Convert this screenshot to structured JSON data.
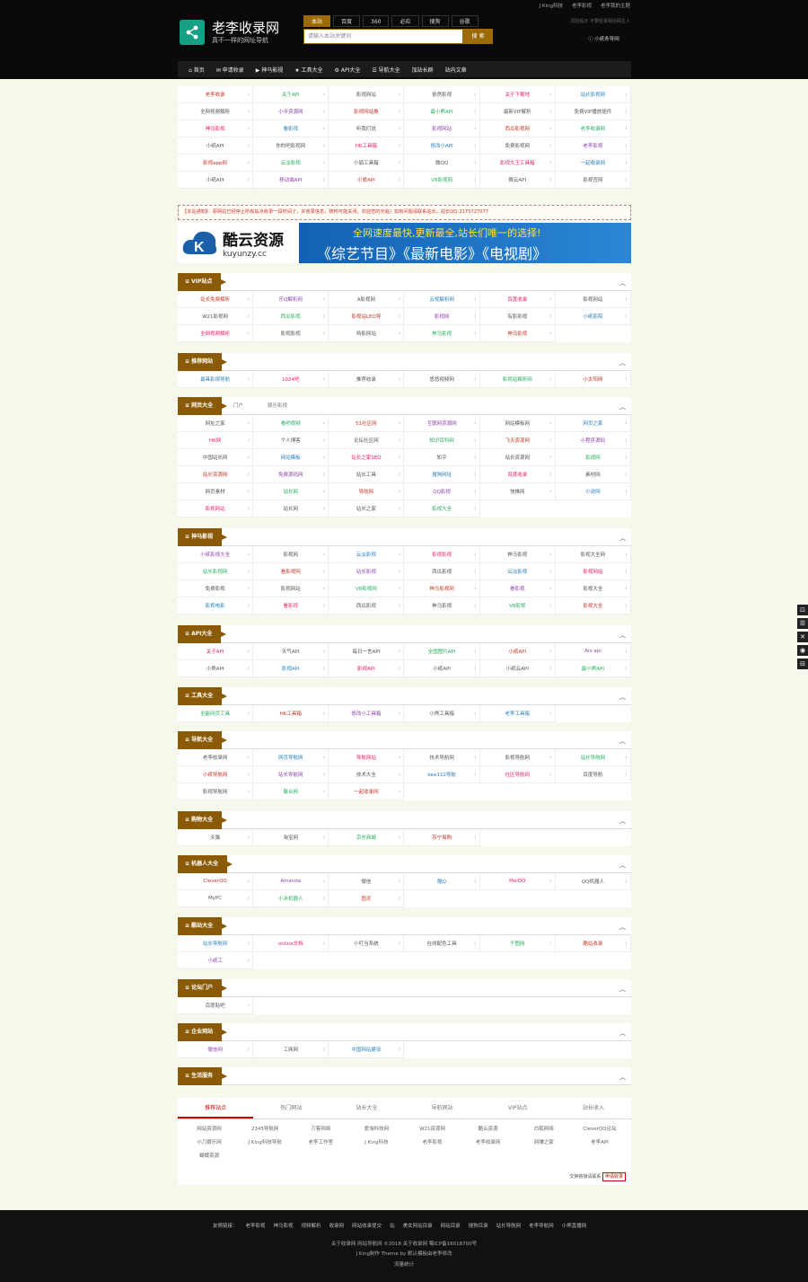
{
  "header": {
    "brand": "老李收录网",
    "slogan": "真不一样的网址导航",
    "search_tabs": [
      "本站",
      "百度",
      "360",
      "必应",
      "搜狗",
      "谷歌"
    ],
    "search_placeholder": "请输入本站关键词",
    "search_button": "搜 索",
    "top_links": [
      "J King科技",
      "老李影视",
      "老李我的主题"
    ],
    "weather": "风险提示 不要轻易相信陌生人",
    "mini": "小纸条导网"
  },
  "nav": [
    "首页",
    "申请收录",
    "神马影视",
    "工具大全",
    "API大全",
    "导航大全",
    "加站长群",
    "站内文章"
  ],
  "top_grid": [
    "老李收录",
    "关于API",
    "影视网站",
    "依然影视",
    "关于下载地",
    "站长影视网",
    "全网视频解析",
    "小伞资源网",
    "影视网站推",
    "最小熊API",
    "最新VIP解析",
    "免费VIP播放插件",
    "神马影视",
    "看影视",
    "听我们说",
    "影视网站",
    "西瓜影视网",
    "老李收录网",
    "小纸API",
    "你的吧影视网",
    "HK工具箱",
    "修改小API",
    "免费影视网",
    "老李影视",
    "影视app网",
    "云淡影视",
    "小狐工具箱",
    "微QQ",
    "影视大王工具箱",
    "一起收录网",
    "小纸API",
    "移动端API",
    "小爱API",
    "V8影视网",
    "微云API",
    "影视官网"
  ],
  "notice": "【本站通知】：原网站已经停止所有站点收录一段时间了，并收录信息，随时可能关闭，欢迎您的光临！如有问题请联系站长。站长QQ:2175727077",
  "banner": {
    "logo_text": "酷云资源",
    "logo_url": "kuyunzy.cc",
    "line1": "全网速度最快,更新最全,站长们唯一的选择!",
    "line2": "《综艺节目》《最新电影》《电视剧》"
  },
  "sections": [
    {
      "title": "VIP站点",
      "items": [
        "站长免费解析",
        "乐Q解析网",
        "A影视网",
        "云视解析网",
        "百度收录",
        "影视网站",
        "W21影视网",
        "西瓜影视",
        "影视站LEO导",
        "影视网",
        "有影影视",
        "小纸影院",
        "全网视频解析",
        "影视影视",
        "特影网站",
        "神马影视",
        "神马影视"
      ]
    },
    {
      "title": "推荐网站",
      "items": [
        "最具影视导航",
        "1024吧",
        "推荐收录",
        "悠悠视频网",
        "影视站解析网",
        "小太阳网"
      ]
    },
    {
      "title": "网页大全",
      "sub": [
        "门户",
        "娱乐影视"
      ],
      "items": [
        "网址之家",
        "看吧视频",
        "51社区网",
        "互联网资源网",
        "网站模板网",
        "网页之家",
        "HK网",
        "个人博客",
        "论坛社区网",
        "知识百科网",
        "飞天资源网",
        "小程序源码",
        "中国站长网",
        "网站模板",
        "站长之家SEO",
        "知乎",
        "站长资源网",
        "影视网",
        "站长资源网",
        "免费源码网",
        "站长工具",
        "搜狗网址",
        "百度收录",
        "素材网",
        "网页素材",
        "站长网",
        "导航网",
        "QQ影视",
        "快推网",
        "小说网",
        "影视网站",
        "站长网",
        "站长之家",
        "影视大全"
      ]
    },
    {
      "title": "神马影视",
      "items": [
        "小纸影视大全",
        "影视网",
        "云淡影视",
        "影视影视",
        "神马影视",
        "影视大全网",
        "站长影视网",
        "看影视网",
        "站长影视",
        "西瓜影视",
        "云淡影视",
        "影视网站",
        "免费影视",
        "影视网站",
        "V8影视网",
        "神马影视网",
        "看影视",
        "影视大全",
        "影视电影",
        "看影视",
        "西瓜影视",
        "神马影视",
        "V8影视",
        "影视大全"
      ]
    },
    {
      "title": "API大全",
      "items": [
        "关于API",
        "天气API",
        "每日一言API",
        "全国图片API",
        "小纸API",
        "Aix api",
        "小熊API",
        "影视API",
        "影视API",
        "小纸API",
        "小纸云API",
        "最小熊API"
      ]
    },
    {
      "title": "工具大全",
      "items": [
        "全能网页工具",
        "HK工具箱",
        "修改小工具箱",
        "小熊工具箱",
        "老李工具箱"
      ]
    },
    {
      "title": "导航大全",
      "items": [
        "老李收录网",
        "网页导航网",
        "导航网站",
        "技术导航网",
        "影视导航网",
        "站长导航网",
        "小纸导航网",
        "站长导航网",
        "技术大全",
        "bee112导航",
        "社区导航网",
        "百度导航",
        "影视导航网",
        "聚合网",
        "一起收录网"
      ]
    },
    {
      "title": "购物大全",
      "items": [
        "天猫",
        "淘宝网",
        "京东商城",
        "苏宁易购"
      ]
    },
    {
      "title": "机器人大全",
      "items": [
        "CleverQQ",
        "Amanda",
        "微信",
        "酷Q",
        "MeiQQ",
        "QQ机器人",
        "MyPC",
        "小冰机器人",
        "图灵"
      ]
    },
    {
      "title": "酷站大全",
      "items": [
        "站长导航网",
        "online文档",
        "小叮当系统",
        "在线配色工具",
        "千图网",
        "酷站收录",
        "小纸工"
      ]
    },
    {
      "title": "论坛门户",
      "items": [
        "百度贴吧"
      ]
    },
    {
      "title": "企业网站",
      "items": [
        "微信网",
        "工商网",
        "中国网站建设"
      ]
    },
    {
      "title": "生活服务",
      "items": []
    }
  ],
  "footer_tabs": [
    "推荐站点",
    "热门网站",
    "站长大全",
    "导航网站",
    "VIP站点",
    "站长收入"
  ],
  "friend_links": [
    "网站资源网",
    "2345导航网",
    "刀客网络",
    "爱淘科技网",
    "W21资源网",
    "酷云资源",
    "白狐网络",
    "CleverQQ论坛",
    "小刀娱乐网",
    "J King科技导航",
    "老李工作室",
    "J King科技",
    "老李影视",
    "老李收录网",
    "网赚之家",
    "老李API",
    "蝴蝶资源"
  ],
  "apply_text": "交换链接请联系",
  "apply_btn": "申请收录",
  "footer_nav": [
    "友情链接：",
    "老李影视",
    "神马影视",
    "视频解析",
    "收录网",
    "网站收录提交",
    "站",
    "美女网站目录",
    "网站目录",
    "搜狗目录",
    "站长导航网",
    "老李导航网",
    "小熊直播网"
  ],
  "footer_line1": "关于收录网 网站导航网 ©2018 关于收录网 蜀ICP备16018700号",
  "footer_line2": "J King制作 Theme by 默认模板由老李修改",
  "footer_line3": "流量统计",
  "side_icons": [
    "top-icon",
    "menu-icon",
    "share-icon",
    "qq-icon",
    "bottom-icon"
  ]
}
